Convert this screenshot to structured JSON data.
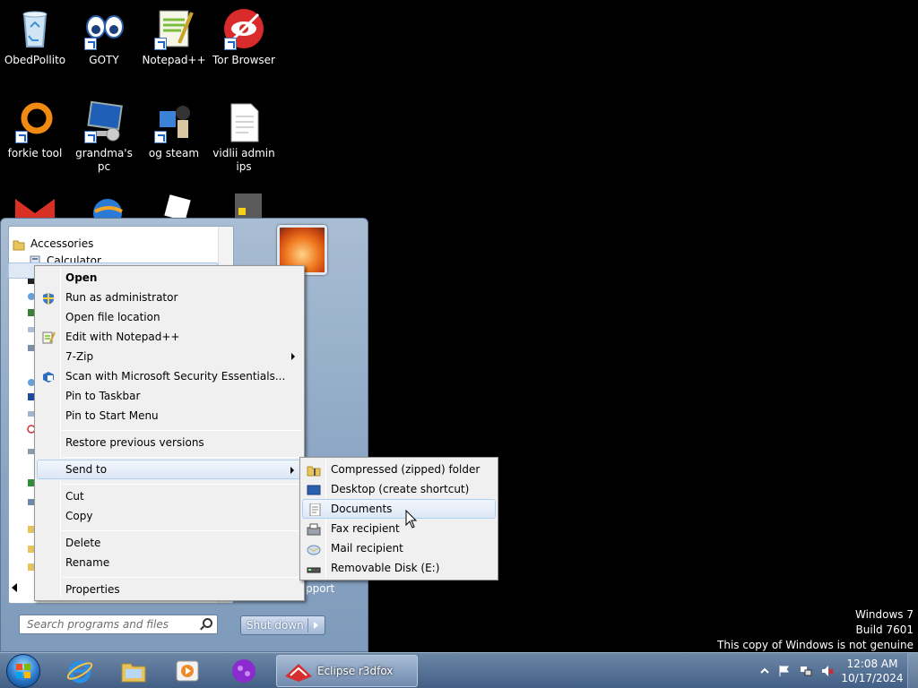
{
  "desktop": {
    "icons": [
      {
        "label": "ObedPollito",
        "icon": "recycle-bin-icon"
      },
      {
        "label": "GOTY",
        "icon": "eyes-icon"
      },
      {
        "label": "Notepad++",
        "icon": "notepad-plus-plus-icon"
      },
      {
        "label": "Tor Browser",
        "icon": "tor-browser-icon"
      },
      {
        "label": "forkie tool",
        "icon": "orange-ring-icon"
      },
      {
        "label": "grandma's pc",
        "icon": "computer-icon"
      },
      {
        "label": "og steam",
        "icon": "steam-puzzle-icon"
      },
      {
        "label": "vidlii admin ips",
        "icon": "text-file-icon"
      }
    ]
  },
  "start_menu": {
    "programs": [
      {
        "label": "Accessories",
        "icon": "folder-icon"
      },
      {
        "label": "Calculator",
        "icon": "calculator-icon"
      }
    ],
    "search_placeholder": "Search programs and files",
    "shutdown_label": "Shut down",
    "support_fragment": "pport"
  },
  "context_menu": {
    "items": [
      {
        "label": "Open",
        "bold": true
      },
      {
        "label": "Run as administrator",
        "icon": "uac-shield-icon"
      },
      {
        "label": "Open file location"
      },
      {
        "label": "Edit with Notepad++",
        "icon": "notepad-plus-plus-icon"
      },
      {
        "label": "7-Zip",
        "submenu": true
      },
      {
        "label": "Scan with Microsoft Security Essentials...",
        "icon": "security-essentials-icon"
      },
      {
        "label": "Pin to Taskbar"
      },
      {
        "label": "Pin to Start Menu"
      },
      {
        "label": "Restore previous versions"
      },
      {
        "label": "Send to",
        "submenu": true,
        "highlighted": true
      },
      {
        "label": "Cut"
      },
      {
        "label": "Copy"
      },
      {
        "label": "Delete"
      },
      {
        "label": "Rename"
      },
      {
        "label": "Properties"
      }
    ]
  },
  "send_to_menu": {
    "items": [
      {
        "label": "Compressed (zipped) folder",
        "icon": "zip-folder-icon"
      },
      {
        "label": "Desktop (create shortcut)",
        "icon": "desktop-icon"
      },
      {
        "label": "Documents",
        "icon": "documents-icon",
        "highlighted": true
      },
      {
        "label": "Fax recipient",
        "icon": "fax-icon"
      },
      {
        "label": "Mail recipient",
        "icon": "mail-icon"
      },
      {
        "label": "Removable Disk (E:)",
        "icon": "removable-disk-icon"
      }
    ]
  },
  "taskbar": {
    "pinned": [
      "internet-explorer-icon",
      "windows-explorer-icon",
      "media-player-icon",
      "purple-orb-app-icon"
    ],
    "active_window": {
      "label": "Eclipse r3dfox",
      "icon": "eclipse-r3dfox-icon"
    },
    "tray": [
      "show-hidden-icons-icon",
      "action-center-flag-icon",
      "network-icon",
      "volume-muted-icon"
    ],
    "clock": {
      "time": "12:08 AM",
      "date": "10/17/2024"
    }
  },
  "watermark": {
    "line1": "Windows 7",
    "line2": "Build 7601",
    "line3": "This copy of Windows is not genuine"
  }
}
